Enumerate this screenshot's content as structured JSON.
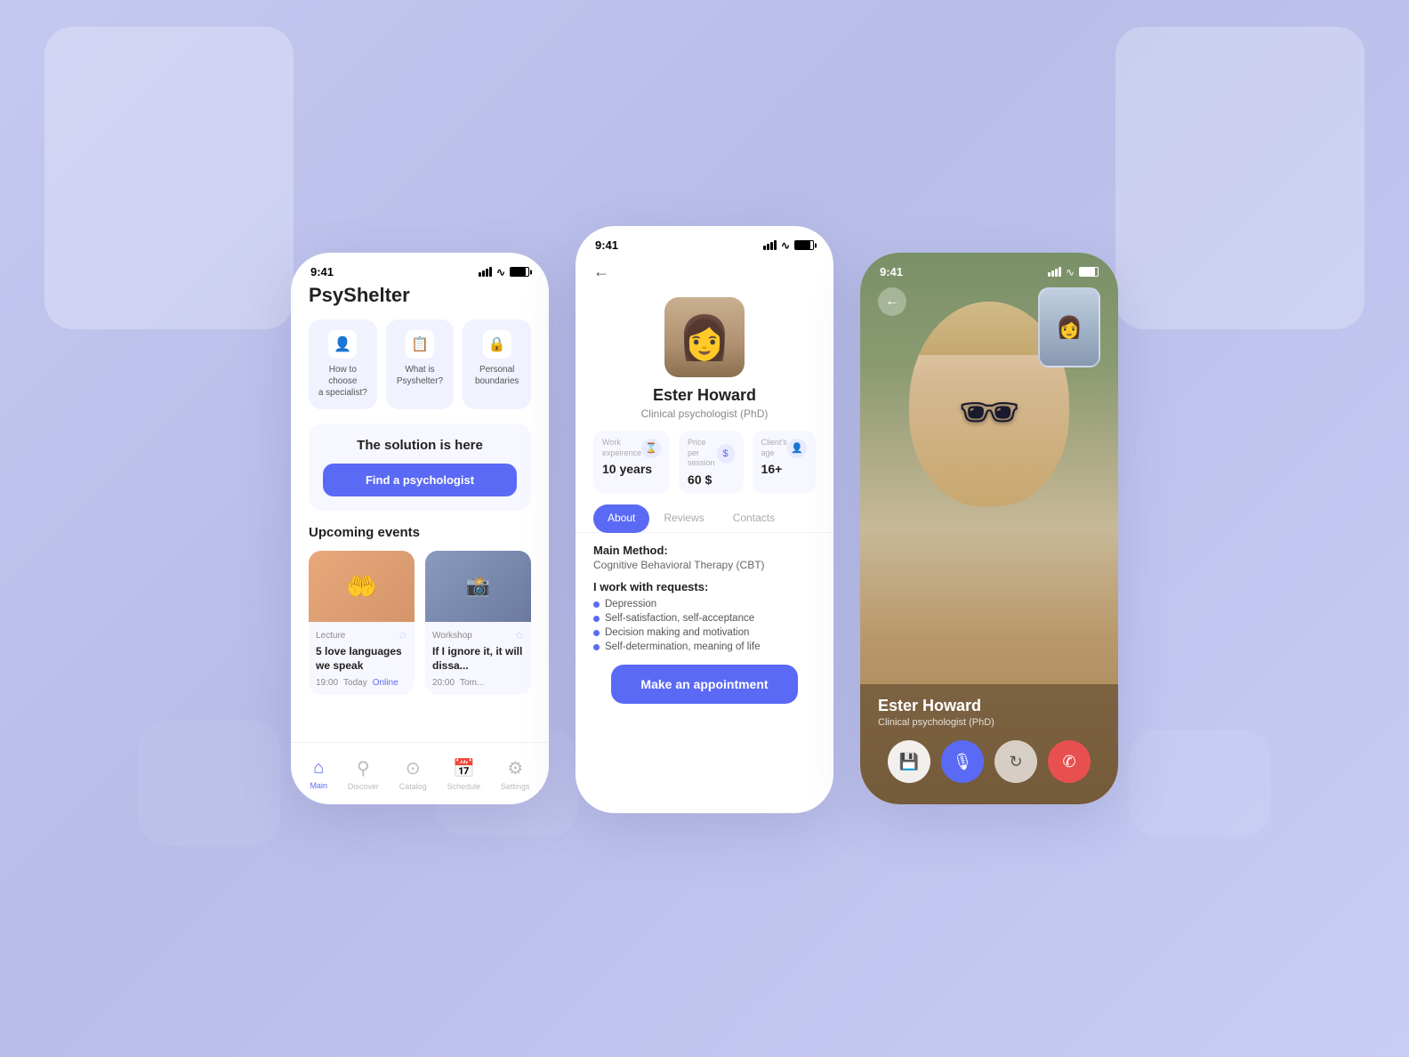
{
  "app": {
    "name": "PsyShelter",
    "status_time": "9:41"
  },
  "phone1": {
    "time": "9:41",
    "quick_actions": [
      {
        "label": "How to choose\na specialist?",
        "icon": "👤"
      },
      {
        "label": "What is\nPsyShelter?",
        "icon": "📋"
      },
      {
        "label": "Personal\nboundaries",
        "icon": "🔒"
      }
    ],
    "solution_title": "The solution is here",
    "find_btn": "Find a psychologist",
    "upcoming_title": "Upcoming events",
    "events": [
      {
        "type": "Lecture",
        "name": "5 love languages we speak",
        "time": "19:00",
        "day": "Today",
        "location": "Online"
      },
      {
        "type": "Workshop",
        "name": "If I ignore it, it will dissa...",
        "time": "20:00",
        "day": "Tom..."
      }
    ],
    "nav_items": [
      "Main",
      "Discover",
      "Catalog",
      "Schedule",
      "Settings"
    ]
  },
  "phone2": {
    "time": "9:41",
    "psychologist_name": "Ester Howard",
    "psychologist_title": "Clinical psychologist (PhD)",
    "stats": [
      {
        "label": "Work experience",
        "value": "10 years"
      },
      {
        "label": "Price per session",
        "value": "60 $"
      },
      {
        "label": "Client's age",
        "value": "16+"
      }
    ],
    "tabs": [
      "About",
      "Reviews",
      "Contacts"
    ],
    "active_tab": "About",
    "main_method_label": "Main Method:",
    "main_method_value": "Cognitive Behavioral Therapy (CBT)",
    "requests_label": "I work with requests:",
    "requests": [
      "Depression",
      "Self-satisfaction, self-acceptance",
      "Decision making and motivation",
      "Self-determination, meaning of life"
    ],
    "appointment_btn": "Make an appointment"
  },
  "phone3": {
    "time": "9:41",
    "caller_name": "Ester Howard",
    "caller_title": "Clinical psychologist (PhD)",
    "controls": [
      "file",
      "mic",
      "rotate",
      "end-call"
    ]
  }
}
